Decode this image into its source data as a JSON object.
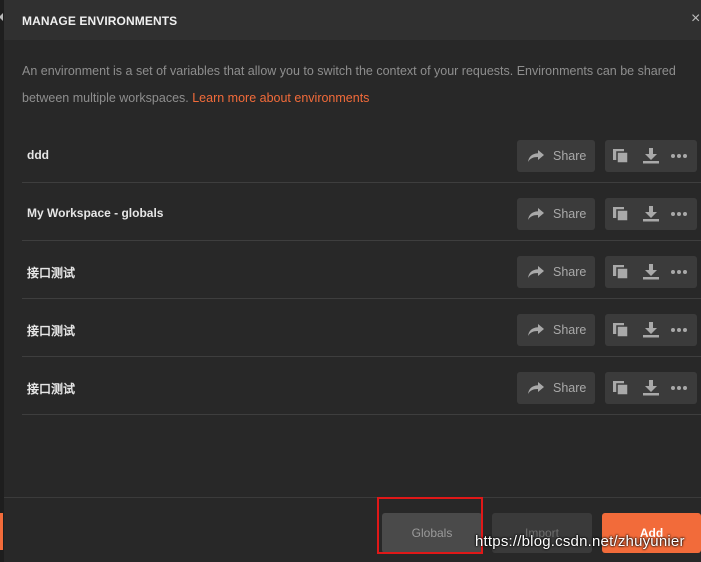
{
  "dialog": {
    "title": "MANAGE ENVIRONMENTS",
    "close_glyph": "×",
    "description": "An environment is a set of variables that allow you to switch the context of your requests. Environments can be shared between multiple workspaces.",
    "learn_more_link": "Learn more about environments"
  },
  "environments": [
    {
      "name": "ddd",
      "share_label": "Share"
    },
    {
      "name": "My Workspace - globals",
      "share_label": "Share"
    },
    {
      "name": "接口测试",
      "share_label": "Share"
    },
    {
      "name": "接口测试",
      "share_label": "Share"
    },
    {
      "name": "接口测试",
      "share_label": "Share"
    }
  ],
  "row_actions": {
    "share_icon": "share-arrow-icon",
    "duplicate_icon": "duplicate-icon",
    "download_icon": "download-icon",
    "more_icon": "more-dots-icon"
  },
  "footer": {
    "globals_label": "Globals",
    "import_label": "Import",
    "add_label": "Add"
  },
  "watermark": "https://blog.csdn.net/zhuyunier",
  "colors": {
    "accent": "#f26b3a",
    "highlight": "#e01818",
    "background": "#282828"
  }
}
